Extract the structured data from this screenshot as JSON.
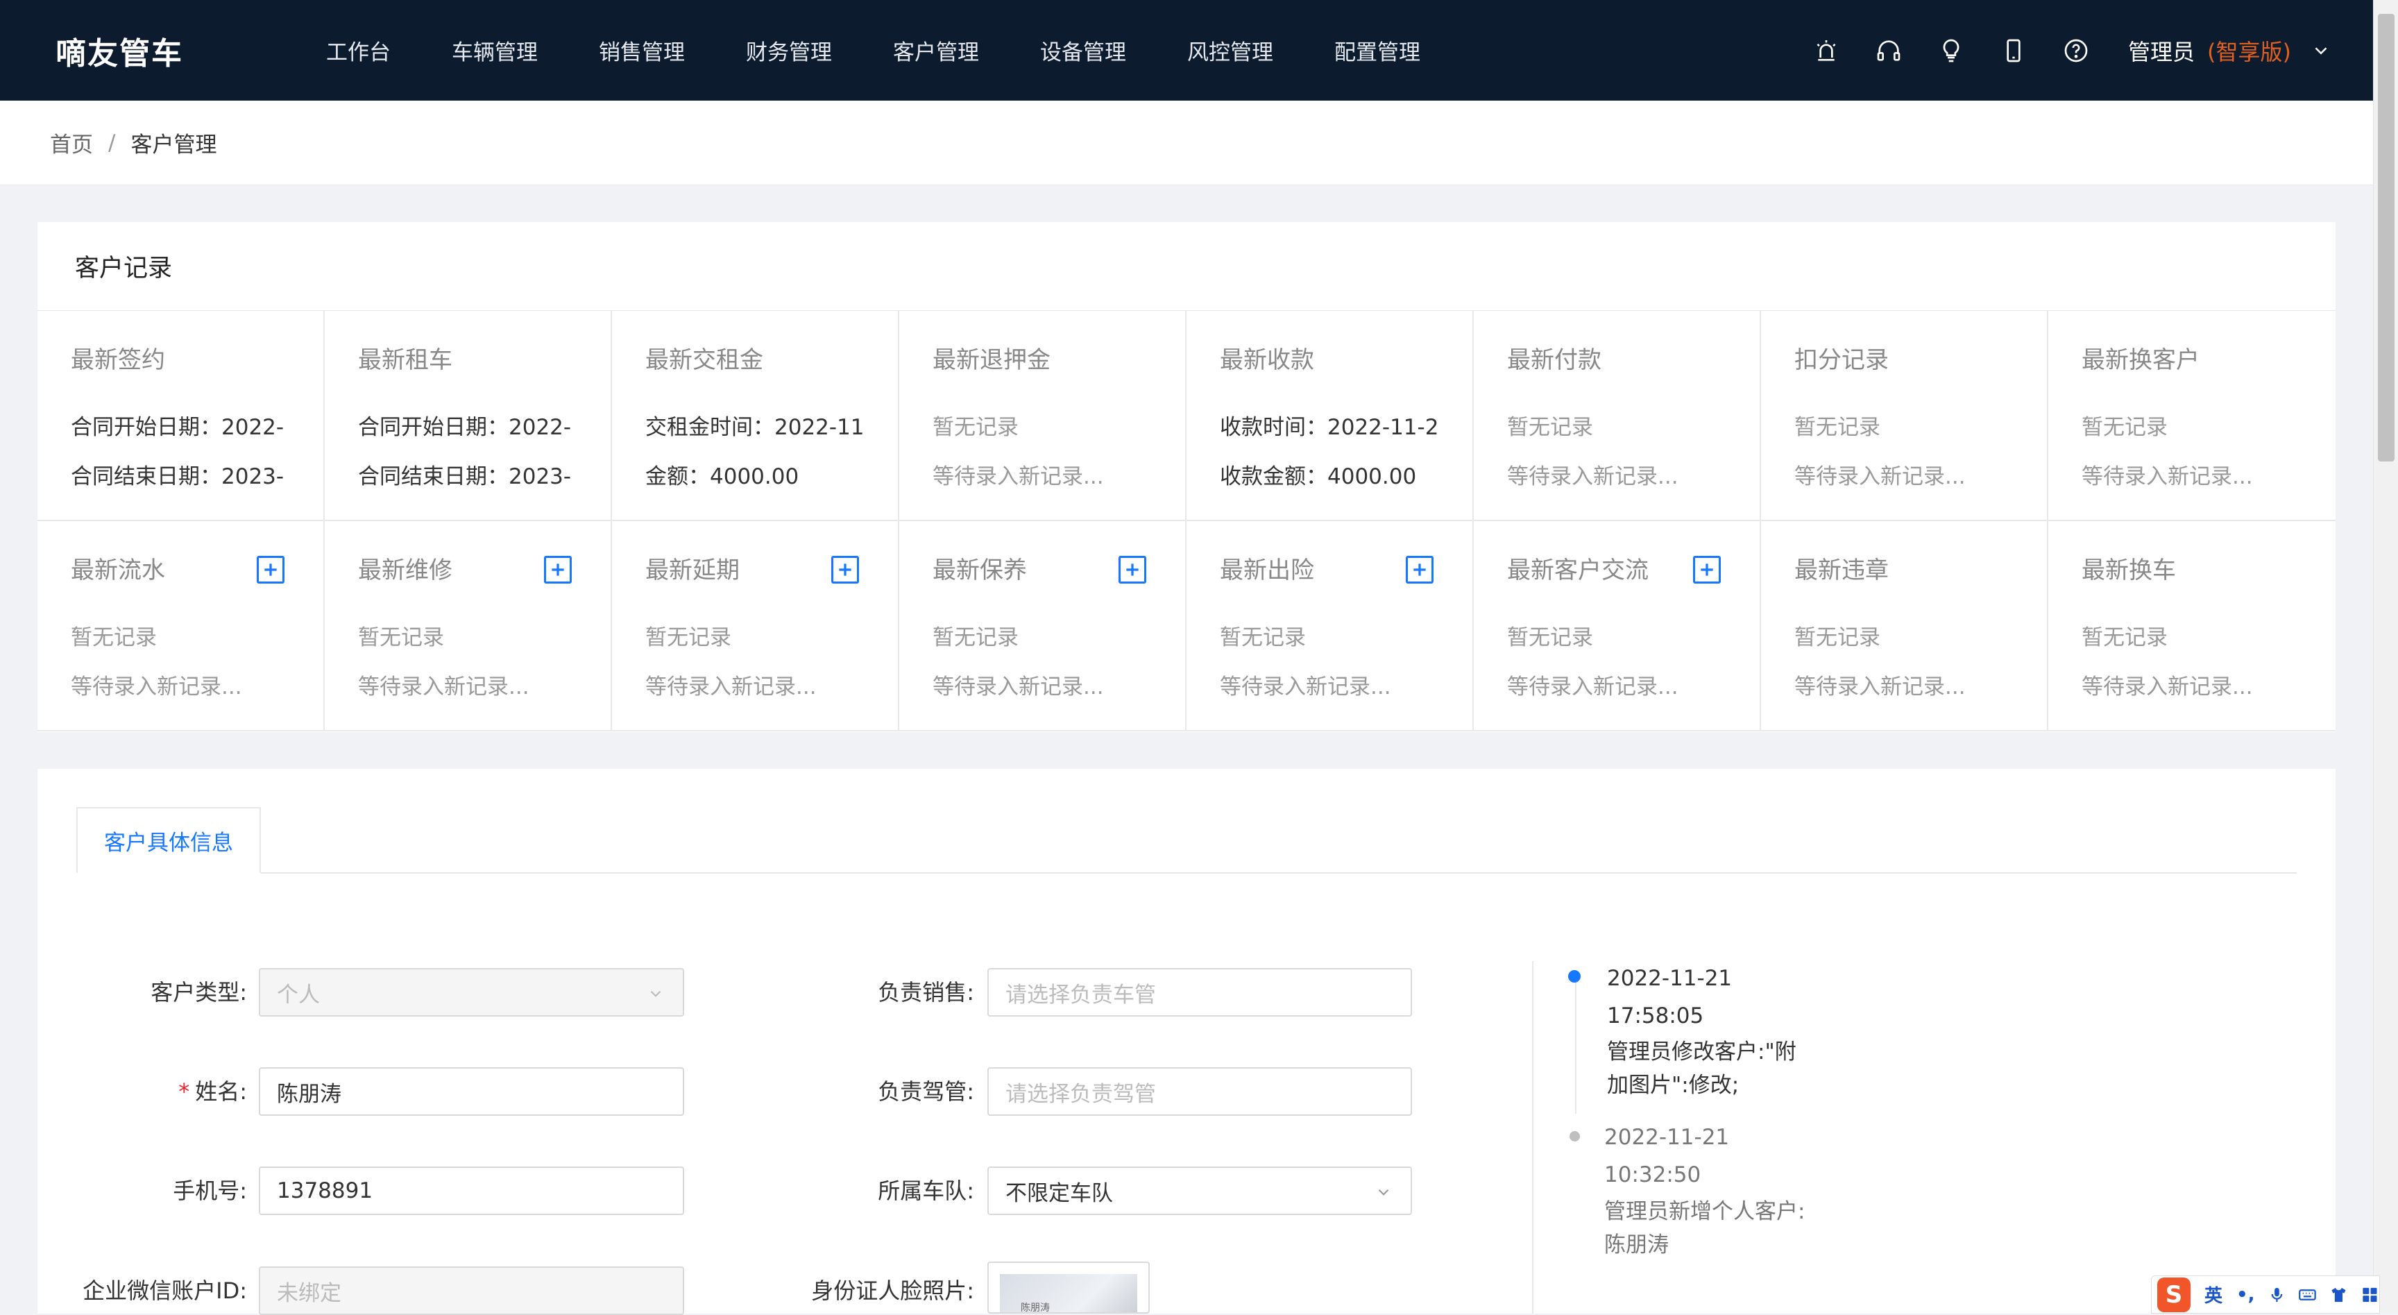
{
  "app": {
    "brand": "嘀友管车",
    "menu": [
      "工作台",
      "车辆管理",
      "销售管理",
      "财务管理",
      "客户管理",
      "设备管理",
      "风控管理",
      "配置管理"
    ],
    "user": {
      "name": "管理员",
      "edition": "(智享版)"
    },
    "icons": [
      "alarm-icon",
      "headset-icon",
      "bulb-icon",
      "mobile-icon",
      "help-icon"
    ]
  },
  "breadcrumb": {
    "home": "首页",
    "separator": "/",
    "current": "客户管理"
  },
  "records": {
    "title": "客户记录",
    "cells": [
      {
        "title": "最新签约",
        "line1": "合同开始日期：2022-",
        "line2": "合同结束日期：2023-",
        "muted": false,
        "add": false
      },
      {
        "title": "最新租车",
        "line1": "合同开始日期：2022-",
        "line2": "合同结束日期：2023-",
        "muted": false,
        "add": false
      },
      {
        "title": "最新交租金",
        "line1": "交租金时间：2022-11",
        "line2": "金额：4000.00",
        "muted": false,
        "add": false
      },
      {
        "title": "最新退押金",
        "line1": "暂无记录",
        "line2": "等待录入新记录...",
        "muted": true,
        "add": false
      },
      {
        "title": "最新收款",
        "line1": "收款时间：2022-11-2",
        "line2": "收款金额：4000.00",
        "muted": false,
        "add": false
      },
      {
        "title": "最新付款",
        "line1": "暂无记录",
        "line2": "等待录入新记录...",
        "muted": true,
        "add": false
      },
      {
        "title": "扣分记录",
        "line1": "暂无记录",
        "line2": "等待录入新记录...",
        "muted": true,
        "add": false
      },
      {
        "title": "最新换客户",
        "line1": "暂无记录",
        "line2": "等待录入新记录...",
        "muted": true,
        "add": false
      },
      {
        "title": "最新流水",
        "line1": "暂无记录",
        "line2": "等待录入新记录...",
        "muted": true,
        "add": true
      },
      {
        "title": "最新维修",
        "line1": "暂无记录",
        "line2": "等待录入新记录...",
        "muted": true,
        "add": true
      },
      {
        "title": "最新延期",
        "line1": "暂无记录",
        "line2": "等待录入新记录...",
        "muted": true,
        "add": true
      },
      {
        "title": "最新保养",
        "line1": "暂无记录",
        "line2": "等待录入新记录...",
        "muted": true,
        "add": true
      },
      {
        "title": "最新出险",
        "line1": "暂无记录",
        "line2": "等待录入新记录...",
        "muted": true,
        "add": true
      },
      {
        "title": "最新客户交流",
        "line1": "暂无记录",
        "line2": "等待录入新记录...",
        "muted": true,
        "add": true
      },
      {
        "title": "最新违章",
        "line1": "暂无记录",
        "line2": "等待录入新记录...",
        "muted": true,
        "add": false
      },
      {
        "title": "最新换车",
        "line1": "暂无记录",
        "line2": "等待录入新记录...",
        "muted": true,
        "add": false
      }
    ]
  },
  "detail": {
    "tab": "客户具体信息",
    "customer_type": {
      "label": "客户类型:",
      "value": "个人"
    },
    "name": {
      "required": "*",
      "label": "姓名:",
      "value": "陈朋涛"
    },
    "phone": {
      "label": "手机号:",
      "value": "1378891"
    },
    "wechat": {
      "label": "企业微信账户ID:",
      "value": "未绑定"
    },
    "sales": {
      "label": "负责销售:",
      "placeholder": "请选择负责车管"
    },
    "driver_mgr": {
      "label": "负责驾管:",
      "placeholder": "请选择负责驾管"
    },
    "fleet": {
      "label": "所属车队:",
      "value": "不限定车队"
    },
    "id_photo": {
      "label": "身份证人脸照片:",
      "caption": "陈朋涛"
    }
  },
  "timeline": [
    {
      "date": "2022-11-21",
      "time": "17:58:05",
      "desc": "管理员修改客户:\"附加图片\":修改;",
      "desc_line1": "管理员修改客户:\"附",
      "desc_line2": "加图片\":修改;",
      "color": "#1677ff"
    },
    {
      "date": "2022-11-21",
      "time": "10:32:50",
      "desc_line1": "管理员新增个人客户:",
      "desc_line2": "陈朋涛",
      "color": "#bfbfbf"
    }
  ],
  "ime": {
    "logo": "S",
    "lang": "英",
    "punct": "•,",
    "icons": [
      "mic-icon",
      "keyboard-icon",
      "shirt-icon",
      "grid-icon"
    ]
  },
  "colors": {
    "nav_bg": "#0d1b2f",
    "accent": "#1677ff",
    "edition": "#e06020"
  }
}
